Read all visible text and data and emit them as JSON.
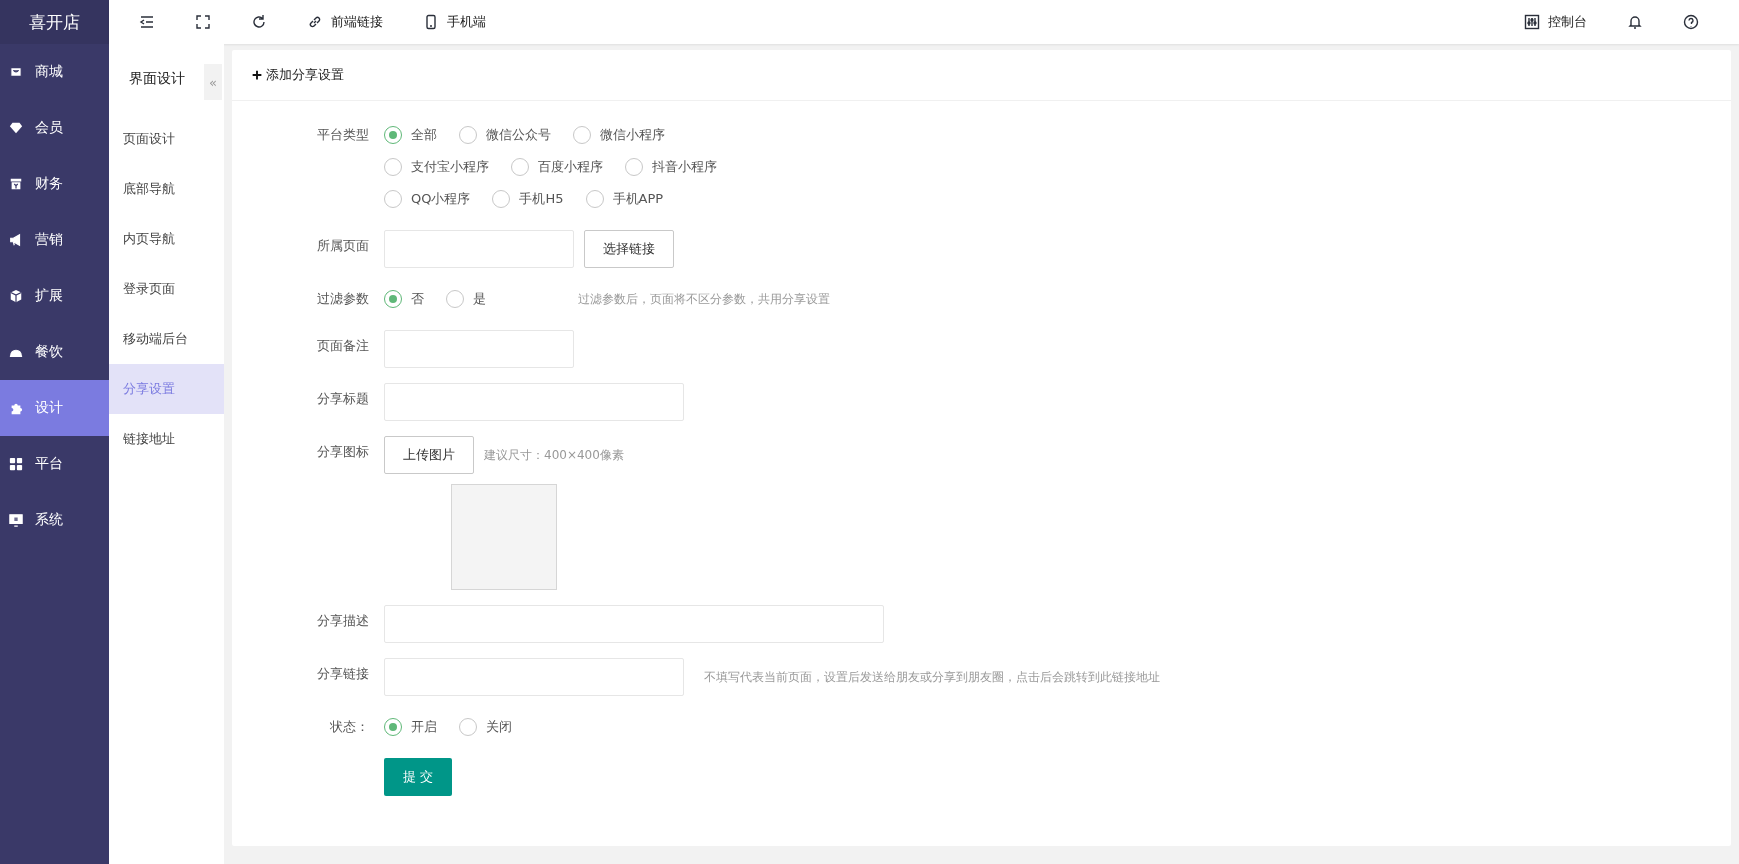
{
  "brand": "喜开店",
  "toolbar": {
    "left": [
      {
        "kind": "menu"
      },
      {
        "kind": "fullscreen"
      },
      {
        "kind": "refresh"
      },
      {
        "kind": "link",
        "label": "前端链接"
      },
      {
        "kind": "phone",
        "label": "手机端"
      }
    ],
    "right": [
      {
        "kind": "console",
        "label": "控制台"
      },
      {
        "kind": "bell"
      },
      {
        "kind": "help"
      }
    ]
  },
  "sidebar": {
    "items": [
      {
        "label": "商城",
        "selected": false
      },
      {
        "label": "会员",
        "selected": false
      },
      {
        "label": "财务",
        "selected": false
      },
      {
        "label": "营销",
        "selected": false
      },
      {
        "label": "扩展",
        "selected": false
      },
      {
        "label": "餐饮",
        "selected": false
      },
      {
        "label": "设计",
        "selected": true
      },
      {
        "label": "平台",
        "selected": false
      },
      {
        "label": "系统",
        "selected": false
      }
    ]
  },
  "subnav": {
    "title": "界面设计",
    "collapse": "«",
    "items": [
      {
        "label": "页面设计",
        "selected": false
      },
      {
        "label": "底部导航",
        "selected": false
      },
      {
        "label": "内页导航",
        "selected": false
      },
      {
        "label": "登录页面",
        "selected": false
      },
      {
        "label": "移动端后台",
        "selected": false
      },
      {
        "label": "分享设置",
        "selected": true
      },
      {
        "label": "链接地址",
        "selected": false
      }
    ]
  },
  "panel": {
    "title": "添加分享设置",
    "form": [
      {
        "kind": "radio",
        "label": "平台类型",
        "lines": [
          [
            {
              "label": "全部",
              "selected": true
            },
            {
              "label": "微信公众号",
              "selected": false
            },
            {
              "label": "微信小程序",
              "selected": false
            }
          ],
          [
            {
              "label": "支付宝小程序",
              "selected": false
            },
            {
              "label": "百度小程序",
              "selected": false
            },
            {
              "label": "抖音小程序",
              "selected": false
            }
          ],
          [
            {
              "label": "QQ小程序",
              "selected": false
            },
            {
              "label": "手机H5",
              "selected": false
            },
            {
              "label": "手机APP",
              "selected": false
            }
          ]
        ]
      },
      {
        "kind": "input",
        "label": "所属页面",
        "button": "选择链接"
      },
      {
        "kind": "radio",
        "label": "过滤参数",
        "lines": [
          [
            {
              "label": "否",
              "selected": true
            },
            {
              "label": "是",
              "selected": false
            }
          ]
        ],
        "hint": "过滤参数后，页面将不区分参数，共用分享设置"
      },
      {
        "kind": "input",
        "label": "页面备注"
      },
      {
        "kind": "input",
        "label": "分享标题"
      },
      {
        "kind": "image",
        "label": "分享图标",
        "button": "上传图片",
        "hint": "建议尺寸：400×400像素"
      },
      {
        "kind": "input",
        "label": "分享描述"
      },
      {
        "kind": "input",
        "label": "分享链接",
        "hint": "不填写代表当前页面，设置后发送给朋友或分享到朋友圈，点击后会跳转到此链接地址"
      },
      {
        "kind": "radio",
        "label": "状态：",
        "lines": [
          [
            {
              "label": "开启",
              "selected": true
            },
            {
              "label": "关闭",
              "selected": false
            }
          ]
        ]
      }
    ],
    "submit": "提 交"
  }
}
